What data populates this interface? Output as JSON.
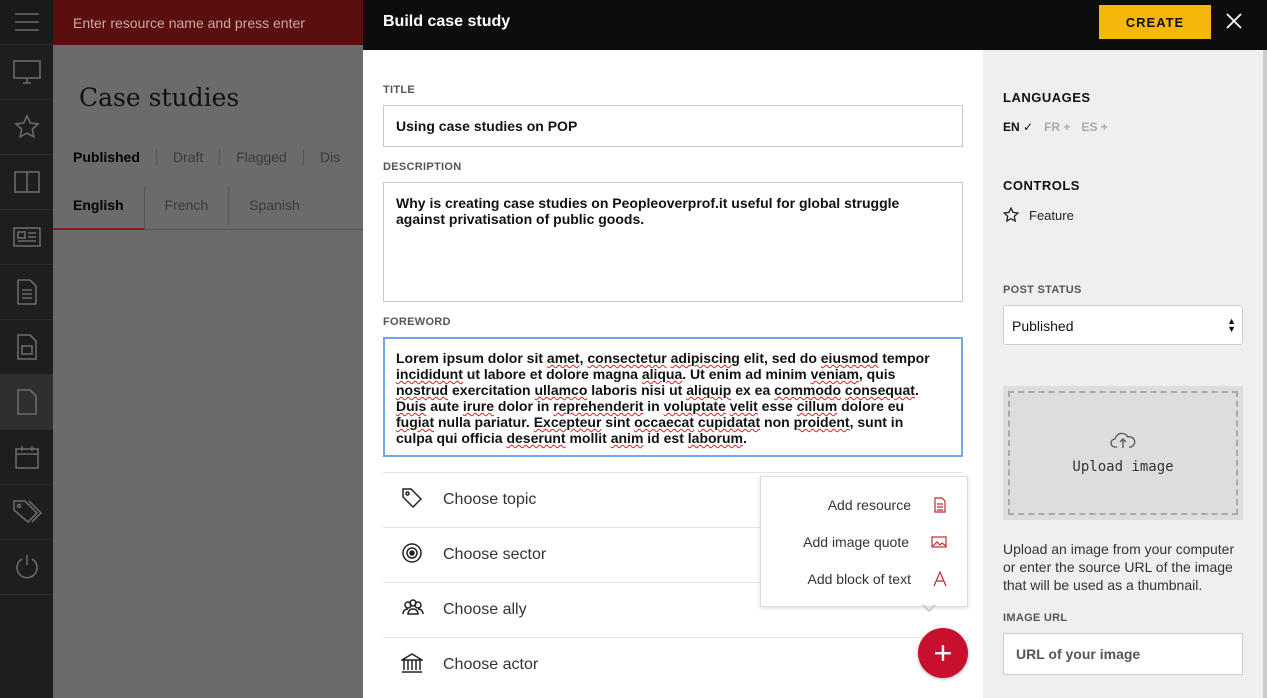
{
  "search": {
    "placeholder": "Enter resource name and press enter"
  },
  "background": {
    "title": "Case studies",
    "status_tabs": [
      "Published",
      "Draft",
      "Flagged",
      "Dis"
    ],
    "language_tabs": [
      "English",
      "French",
      "Spanish"
    ]
  },
  "modal": {
    "title": "Build case study",
    "create_label": "CREATE",
    "title_label": "TITLE",
    "title_value": "Using case studies on POP",
    "description_label": "DESCRIPTION",
    "description_value": "Why is creating case studies on Peopleoverprof.it useful for global struggle against privatisation of public goods.",
    "foreword_label": "FOREWORD",
    "choosers": [
      "Choose topic",
      "Choose sector",
      "Choose ally",
      "Choose actor"
    ],
    "add_menu": [
      "Add resource",
      "Add image quote",
      "Add block of text"
    ],
    "fab_label": "+"
  },
  "sidebar": {
    "languages_heading": "LANGUAGES",
    "languages": [
      {
        "code": "EN",
        "mark": "✓"
      },
      {
        "code": "FR",
        "mark": "+"
      },
      {
        "code": "ES",
        "mark": "+"
      }
    ],
    "controls_heading": "CONTROLS",
    "feature_label": "Feature",
    "post_status_label": "POST STATUS",
    "post_status_value": "Published",
    "upload_label": "Upload image",
    "upload_help": "Upload an image from your computer or enter the source URL of the image that will be used as a thumbnail.",
    "image_url_label": "IMAGE URL",
    "image_url_placeholder": "URL of your image"
  },
  "colors": {
    "accent": "#f5b70b",
    "brand_red": "#c8102e",
    "focus_blue": "#6ea8e8"
  }
}
